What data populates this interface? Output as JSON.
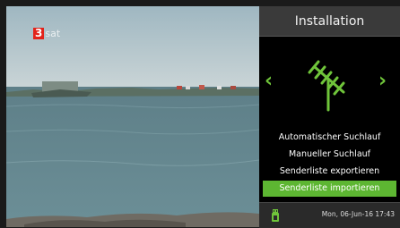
{
  "video": {
    "channel_logo_number": "3",
    "channel_logo_text": "sat"
  },
  "panel": {
    "title": "Installation",
    "icon": "antenna-icon",
    "nav": {
      "left_glyph": "‹",
      "right_glyph": "›"
    },
    "menu": [
      {
        "label": "Automatischer Suchlauf",
        "selected": false
      },
      {
        "label": "Manueller Suchlauf",
        "selected": false
      },
      {
        "label": "Senderliste exportieren",
        "selected": false
      },
      {
        "label": "Senderliste importieren",
        "selected": true
      }
    ],
    "footer": {
      "icon": "usb-icon",
      "datetime": "Mon, 06-Jun-16  17:43"
    }
  },
  "colors": {
    "accent": "#5db632",
    "logo_red": "#e2231a"
  }
}
